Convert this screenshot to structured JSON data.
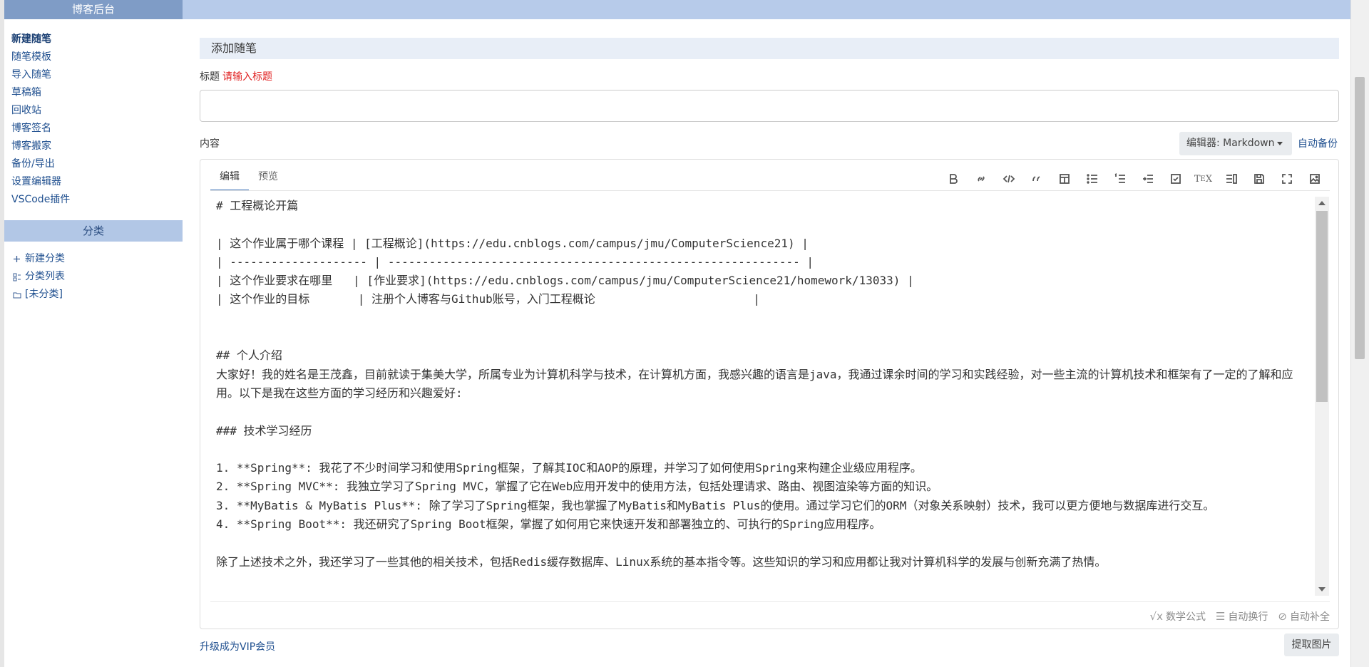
{
  "sidebar": {
    "header": "博客后台",
    "items": [
      "新建随笔",
      "随笔模板",
      "导入随笔",
      "草稿箱",
      "回收站",
      "博客签名",
      "博客搬家",
      "备份/导出",
      "设置编辑器",
      "VSCode插件"
    ],
    "category_header": "分类",
    "category_items": [
      {
        "icon": "plus-icon",
        "label": "新建分类"
      },
      {
        "icon": "list-icon",
        "label": "分类列表"
      },
      {
        "icon": "folder-icon",
        "label": "[未分类]"
      }
    ]
  },
  "main": {
    "section_title": "添加随笔",
    "title_label": "标题",
    "title_warning": "请输入标题",
    "content_label": "内容",
    "editor_select": "编辑器: Markdown",
    "autosave": "自动备份",
    "tabs": [
      "编辑",
      "预览"
    ],
    "toolbar_icons": [
      "bold-icon",
      "link-icon",
      "code-icon",
      "quote-icon",
      "table-icon",
      "bullet-list-icon",
      "numbered-list-icon",
      "indent-icon",
      "checkbox-icon",
      "tex-icon",
      "toc-icon",
      "save-icon",
      "fullscreen-icon",
      "image-icon"
    ],
    "code_lines": [
      "# 工程概论开篇",
      "",
      "| 这个作业属于哪个课程 | [工程概论](https://edu.cnblogs.com/campus/jmu/ComputerScience21) |",
      "| -------------------- | ------------------------------------------------------------ |",
      "| 这个作业要求在哪里   | [作业要求](https://edu.cnblogs.com/campus/jmu/ComputerScience21/homework/13033) |",
      "| 这个作业的目标       | 注册个人博客与Github账号，入门工程概论                       |",
      "",
      "",
      "## 个人介绍",
      "大家好！我的姓名是王茂鑫，目前就读于集美大学，所属专业为计算机科学与技术，在计算机方面，我感兴趣的语言是java，我通过课余时间的学习和实践经验，对一些主流的计算机技术和框架有了一定的了解和应用。以下是我在这些方面的学习经历和兴趣爱好:",
      "",
      "### 技术学习经历",
      "",
      "1. **Spring**: 我花了不少时间学习和使用Spring框架，了解其IOC和AOP的原理，并学习了如何使用Spring来构建企业级应用程序。",
      "2. **Spring MVC**: 我独立学习了Spring MVC，掌握了它在Web应用开发中的使用方法，包括处理请求、路由、视图渲染等方面的知识。",
      "3. **MyBatis & MyBatis Plus**: 除了学习了Spring框架，我也掌握了MyBatis和MyBatis Plus的使用。通过学习它们的ORM（对象关系映射）技术，我可以更方便地与数据库进行交互。",
      "4. **Spring Boot**: 我还研究了Spring Boot框架，掌握了如何用它来快速开发和部署独立的、可执行的Spring应用程序。",
      "",
      "除了上述技术之外，我还学习了一些其他的相关技术，包括Redis缓存数据库、Linux系统的基本指令等。这些知识的学习和应用都让我对计算机科学的发展与创新充满了热情。"
    ],
    "status": [
      {
        "icon": "sqrt-icon",
        "label": "数学公式"
      },
      {
        "icon": "wrap-icon",
        "label": "自动换行"
      },
      {
        "icon": "autocomplete-off-icon",
        "label": "自动补全"
      }
    ],
    "vip_link": "升级成为VIP会员",
    "extract_button": "提取图片"
  }
}
